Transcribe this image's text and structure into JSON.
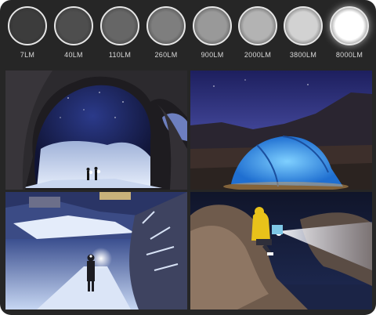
{
  "brightness_levels": [
    {
      "label": "7LM",
      "fill": "#3c3c3c"
    },
    {
      "label": "40LM",
      "fill": "#4e4e4e"
    },
    {
      "label": "110LM",
      "fill": "#666666"
    },
    {
      "label": "260LM",
      "fill": "#7e7e7e"
    },
    {
      "label": "900LM",
      "fill": "#999999"
    },
    {
      "label": "2000LM",
      "fill": "#b3b3b3"
    },
    {
      "label": "3800LM",
      "fill": "#d2d2d2"
    },
    {
      "label": "8000LM",
      "fill": "#ffffff"
    }
  ],
  "photos": [
    {
      "subject": "snowy cave opening under a night sky with two people holding lights",
      "icon": "cave-photo"
    },
    {
      "subject": "illuminated blue tent below mountains at dusk",
      "icon": "tent-photo"
    },
    {
      "subject": "hiker with headlamp on a snowy forest road at night",
      "icon": "snow-road-photo"
    },
    {
      "subject": "person in yellow jacket sitting on a rock shining a flashlight",
      "icon": "rock-flashlight-photo"
    }
  ],
  "colors": {
    "frame": "#262626",
    "night_sky": "#1b1f4d",
    "tent": "#2f8fe8",
    "jacket": "#e8c21a"
  }
}
